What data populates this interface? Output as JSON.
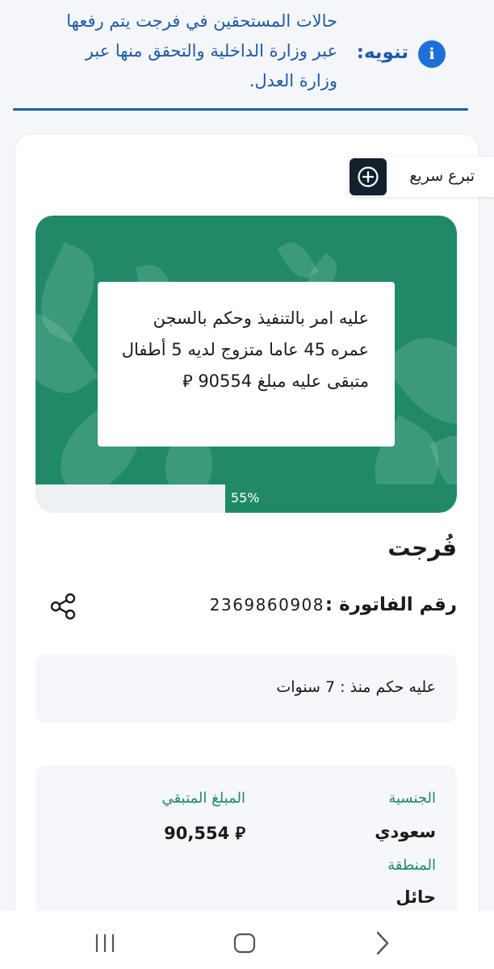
{
  "notice": {
    "label": "تنويه:",
    "text": "حالات المستحقين في فرجت يتم رفعها عبر وزارة الداخلية والتحقق منها عبر وزارة العدل.",
    "icon": "info-icon",
    "color": "#1e5aa8"
  },
  "quick_donate": {
    "label": "تبرع سريع",
    "icon": "plus-circle-icon"
  },
  "banner": {
    "text": "عليه امر بالتنفيذ وحكم بالسجن عمره 45 عاما متزوج لديه 5 أطفال متبقى عليه مبلغ 90554 ⃁",
    "color": "#208a68"
  },
  "progress": {
    "label": "55%",
    "value": 0.55
  },
  "case": {
    "title": "فُرجت",
    "invoice_label": "رقم الفاتورة :",
    "invoice_number": "2369860908",
    "sentence": "عليه حكم منذ : 7 سنوات"
  },
  "details": {
    "nationality_label": "الجنسية",
    "nationality_value": "سعودي",
    "remaining_label": "المبلغ المتبقي",
    "remaining_value": "90,554",
    "currency_symbol": "⃁",
    "region_label": "المنطقة",
    "region_value": "حائل"
  },
  "navbar": {
    "recents_icon": "recents-icon",
    "home_icon": "home-icon",
    "back_icon": "back-icon"
  }
}
